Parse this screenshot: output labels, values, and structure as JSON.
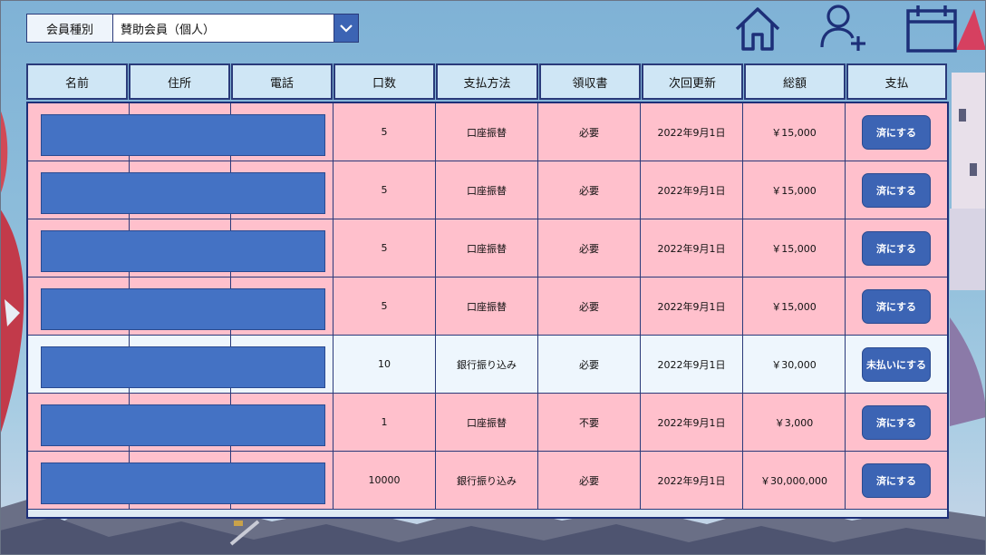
{
  "filter": {
    "label": "会員種別",
    "selected": "賛助会員（個人）"
  },
  "toolbar": {
    "home_icon": "home-icon",
    "add_user_icon": "add-user-icon",
    "calendar_icon": "calendar-icon"
  },
  "table": {
    "headers": [
      "名前",
      "住所",
      "電話",
      "口数",
      "支払方法",
      "領収書",
      "次回更新",
      "総額",
      "支払"
    ],
    "rows": [
      {
        "units": "5",
        "method": "口座振替",
        "receipt": "必要",
        "renewal": "2022年9月1日",
        "total": "￥15,000",
        "action": "済にする",
        "status": "pink"
      },
      {
        "units": "5",
        "method": "口座振替",
        "receipt": "必要",
        "renewal": "2022年9月1日",
        "total": "￥15,000",
        "action": "済にする",
        "status": "pink"
      },
      {
        "units": "5",
        "method": "口座振替",
        "receipt": "必要",
        "renewal": "2022年9月1日",
        "total": "￥15,000",
        "action": "済にする",
        "status": "pink"
      },
      {
        "units": "5",
        "method": "口座振替",
        "receipt": "必要",
        "renewal": "2022年9月1日",
        "total": "￥15,000",
        "action": "済にする",
        "status": "pink"
      },
      {
        "units": "10",
        "method": "銀行振り込み",
        "receipt": "必要",
        "renewal": "2022年9月1日",
        "total": "￥30,000",
        "action": "未払いにする",
        "status": "blue"
      },
      {
        "units": "1",
        "method": "口座振替",
        "receipt": "不要",
        "renewal": "2022年9月1日",
        "total": "￥3,000",
        "action": "済にする",
        "status": "pink"
      },
      {
        "units": "10000",
        "method": "銀行振り込み",
        "receipt": "必要",
        "renewal": "2022年9月1日",
        "total": "￥30,000,000",
        "action": "済にする",
        "status": "pink"
      }
    ]
  },
  "colors": {
    "unpaid_row": "#ffc0cc",
    "paid_row": "#eef6fd",
    "accent": "#3c64b4",
    "border": "#2a3a7a"
  }
}
